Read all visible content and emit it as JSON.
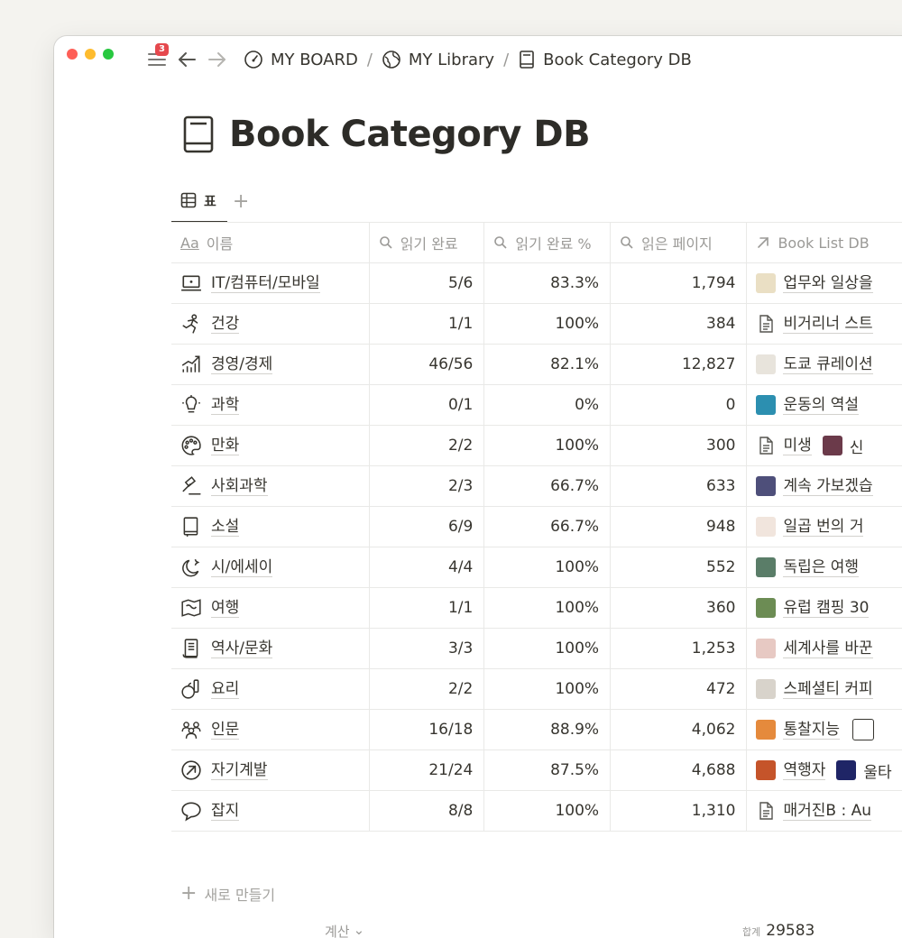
{
  "topbar": {
    "notification_count": "3",
    "breadcrumbs": [
      {
        "label": "MY BOARD",
        "icon": "gauge-icon"
      },
      {
        "label": "MY Library",
        "icon": "globe-icon"
      },
      {
        "label": "Book Category DB",
        "icon": "book-icon"
      }
    ],
    "separator": "/"
  },
  "page": {
    "title": "Book Category DB",
    "view_tab": "표",
    "add_view": "+"
  },
  "table": {
    "columns": [
      {
        "label": "이름",
        "prefix": "Aa"
      },
      {
        "label": "읽기 완료",
        "icon": "search-icon"
      },
      {
        "label": "읽기 완료 %",
        "icon": "search-icon"
      },
      {
        "label": "읽은 페이지",
        "icon": "search-icon"
      },
      {
        "label": "Book List DB",
        "icon": "arrow-up-right-icon"
      }
    ],
    "rows": [
      {
        "name": "IT/컴퓨터/모바일",
        "icon": "laptop-icon",
        "done": "5/6",
        "pct": "83.3%",
        "pages": "1,794",
        "link": "업무와 일상을",
        "thumb": "#eadfc4",
        "thumb_icon": "book-cover-icon"
      },
      {
        "name": "건강",
        "icon": "runner-icon",
        "done": "1/1",
        "pct": "100%",
        "pages": "384",
        "link": "비거리너 스트",
        "thumb": "#ffffff",
        "thumb_icon": "document-icon"
      },
      {
        "name": "경영/경제",
        "icon": "chart-growth-icon",
        "done": "46/56",
        "pct": "82.1%",
        "pages": "12,827",
        "link": "도쿄 큐레이션",
        "thumb": "#e8e4dc",
        "thumb_icon": "book-cover-icon"
      },
      {
        "name": "과학",
        "icon": "lightbulb-icon",
        "done": "0/1",
        "pct": "0%",
        "pages": "0",
        "link": "운동의 역설",
        "thumb": "#2c8fb0",
        "thumb_icon": "book-cover-icon"
      },
      {
        "name": "만화",
        "icon": "palette-icon",
        "done": "2/2",
        "pct": "100%",
        "pages": "300",
        "link": "미생",
        "thumb": "#ffffff",
        "thumb_icon": "document-icon",
        "extra_thumb": "#6b3a4a",
        "extra_text": "신"
      },
      {
        "name": "사회과학",
        "icon": "gavel-icon",
        "done": "2/3",
        "pct": "66.7%",
        "pages": "633",
        "link": "계속 가보겠습",
        "thumb": "#4e4f7a",
        "thumb_icon": "book-cover-icon"
      },
      {
        "name": "소설",
        "icon": "reader-icon",
        "done": "6/9",
        "pct": "66.7%",
        "pages": "948",
        "link": "일곱 번의 거",
        "thumb": "#f1e5dd",
        "thumb_icon": "book-cover-icon"
      },
      {
        "name": "시/에세이",
        "icon": "moon-stars-icon",
        "done": "4/4",
        "pct": "100%",
        "pages": "552",
        "link": "독립은 여행",
        "thumb": "#5a7d68",
        "thumb_icon": "book-cover-icon"
      },
      {
        "name": "여행",
        "icon": "map-icon",
        "done": "1/1",
        "pct": "100%",
        "pages": "360",
        "link": "유럽 캠핑 30",
        "thumb": "#6c8c54",
        "thumb_icon": "book-cover-icon"
      },
      {
        "name": "역사/문화",
        "icon": "scroll-icon",
        "done": "3/3",
        "pct": "100%",
        "pages": "1,253",
        "link": "세계사를 바꾼",
        "thumb": "#e7c9c3",
        "thumb_icon": "book-cover-icon"
      },
      {
        "name": "요리",
        "icon": "apple-bottle-icon",
        "done": "2/2",
        "pct": "100%",
        "pages": "472",
        "link": "스페셜티 커피",
        "thumb": "#d8d3cb",
        "thumb_icon": "book-cover-icon"
      },
      {
        "name": "인문",
        "icon": "people-icon",
        "done": "16/18",
        "pct": "88.9%",
        "pages": "4,062",
        "link": "통찰지능",
        "thumb": "#e58a3c",
        "thumb_icon": "book-cover-icon",
        "extra_outline": true
      },
      {
        "name": "자기계발",
        "icon": "arrow-circle-icon",
        "done": "21/24",
        "pct": "87.5%",
        "pages": "4,688",
        "link": "역행자",
        "thumb": "#c5542a",
        "thumb_icon": "book-cover-icon",
        "extra_thumb": "#1f2566",
        "extra_text": "울타"
      },
      {
        "name": "잡지",
        "icon": "speech-bubble-icon",
        "done": "8/8",
        "pct": "100%",
        "pages": "1,310",
        "link": "매거진B : Au",
        "thumb": "#ffffff",
        "thumb_icon": "document-icon"
      }
    ]
  },
  "new_row": "새로 만들기",
  "footer": {
    "calc_label": "계산",
    "sum_label": "합계",
    "sum_value": "29583"
  }
}
